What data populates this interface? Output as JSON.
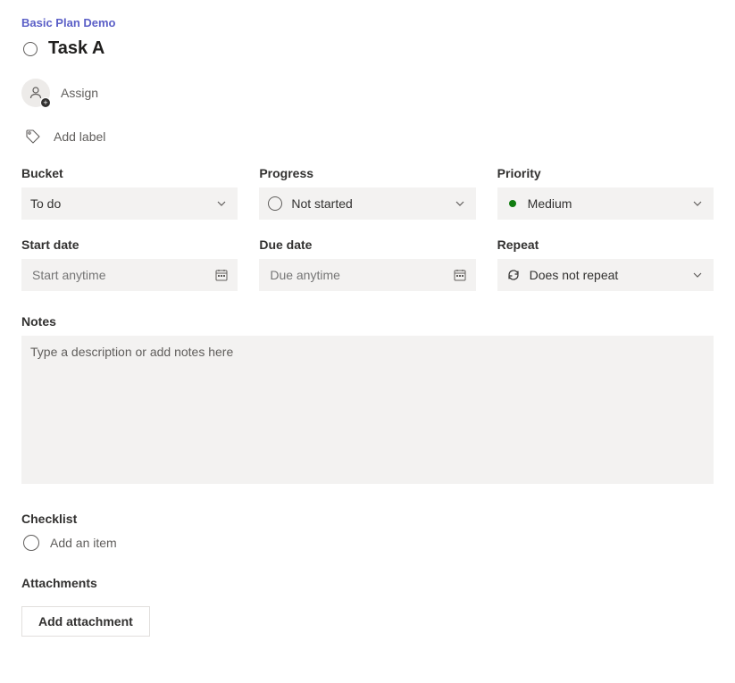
{
  "plan_name": "Basic Plan Demo",
  "task_title": "Task A",
  "assign_label": "Assign",
  "add_label_text": "Add label",
  "fields": {
    "bucket": {
      "label": "Bucket",
      "value": "To do"
    },
    "progress": {
      "label": "Progress",
      "value": "Not started"
    },
    "priority": {
      "label": "Priority",
      "value": "Medium"
    },
    "start_date": {
      "label": "Start date",
      "placeholder": "Start anytime"
    },
    "due_date": {
      "label": "Due date",
      "placeholder": "Due anytime"
    },
    "repeat": {
      "label": "Repeat",
      "value": "Does not repeat"
    }
  },
  "notes": {
    "label": "Notes",
    "placeholder": "Type a description or add notes here"
  },
  "checklist": {
    "label": "Checklist",
    "add_item_text": "Add an item"
  },
  "attachments": {
    "label": "Attachments",
    "button": "Add attachment"
  }
}
